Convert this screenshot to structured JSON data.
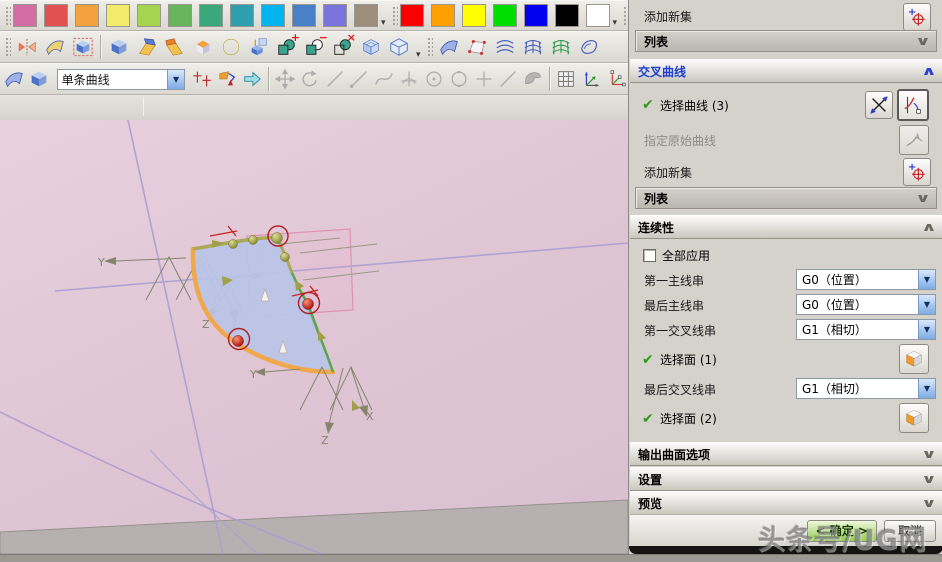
{
  "toolbar": {
    "palette1_colors": [
      "#d46da5",
      "#e05252",
      "#f5a23e",
      "#f2ea6a",
      "#a5d44e",
      "#68b55e",
      "#3aa87a",
      "#2f9fae",
      "#00b4f0",
      "#4a80c8",
      "#7b74dc",
      "#9c8d7c"
    ],
    "palette2_colors": [
      "#fa0000",
      "#ffa000",
      "#ffff00",
      "#00dd00",
      "#0000ee",
      "#000000",
      "#ffffff"
    ],
    "curve_rule_value": "单条曲线",
    "row2_icons": [
      {
        "type": "grip"
      },
      {
        "name": "mirror-feature-icon",
        "sym": "sym-mirror"
      },
      {
        "name": "sheet-body-icon",
        "sym": "sym-sheet2"
      },
      {
        "name": "sew-solid-icon",
        "sym": "sym-dashcube"
      },
      {
        "type": "sep"
      },
      {
        "name": "chamfer-cube-icon",
        "sym": "sym-cube"
      },
      {
        "name": "bend-sheet-icon",
        "sym": "sym-bend"
      },
      {
        "name": "flange-sheet-icon",
        "sym": "sym-bend2"
      },
      {
        "name": "thicken-sheet-icon",
        "sym": "sym-extrude"
      },
      {
        "name": "sphere-icon",
        "sym": "sym-sphere"
      },
      {
        "name": "boss-feature-icon",
        "sym": "sym-boss"
      },
      {
        "name": "unite-boolean-icon",
        "sym": "sym-bool-u",
        "badge": "+"
      },
      {
        "name": "subtract-boolean-icon",
        "sym": "sym-bool-s",
        "badge": "−"
      },
      {
        "name": "intersect-boolean-icon",
        "sym": "sym-bool-i",
        "badge": "×"
      },
      {
        "name": "shell-icon",
        "sym": "sym-shell"
      },
      {
        "name": "wireframe-cube-icon",
        "sym": "sym-wire"
      },
      {
        "type": "arrow"
      },
      {
        "type": "grip"
      },
      {
        "name": "swept-surface-icon",
        "sym": "sym-swept"
      },
      {
        "name": "bounded-plane-icon",
        "sym": "sym-plane"
      },
      {
        "name": "through-curves-icon",
        "sym": "sym-curves",
        "color": "#4a5fc0"
      },
      {
        "name": "through-curve-mesh-icon",
        "sym": "sym-mesh",
        "color": "#4a5fc0"
      },
      {
        "name": "studio-surface-icon",
        "sym": "sym-mesh",
        "color": "#2e9a4e"
      },
      {
        "name": "n-sided-surface-icon",
        "sym": "sym-nsided",
        "color": "#4a5fc0"
      }
    ],
    "row3_icons": [
      {
        "name": "extract-sheet-icon",
        "sym": "sym-swept"
      },
      {
        "name": "solid-cube-icon",
        "sym": "sym-cube"
      },
      {
        "type": "combo"
      },
      {
        "name": "point-constructor-icon",
        "sym": "sym-crosses"
      },
      {
        "name": "point-dialog-icon",
        "sym": "sym-pointdlg"
      },
      {
        "name": "direction-arrow-icon",
        "sym": "sym-cyanarrow"
      },
      {
        "type": "sep"
      },
      {
        "name": "move-handles-icon",
        "sym": "sym-move",
        "grayed": true
      },
      {
        "name": "rotate-handles-icon",
        "sym": "sym-rotate",
        "grayed": true
      },
      {
        "name": "line-icon",
        "sym": "sym-line",
        "grayed": true
      },
      {
        "name": "line-point-icon",
        "sym": "sym-linept",
        "grayed": true
      },
      {
        "name": "spline-icon",
        "sym": "sym-spline",
        "grayed": true
      },
      {
        "name": "arc-cross-icon",
        "sym": "sym-arc",
        "grayed": true
      },
      {
        "name": "circle-center-icon",
        "sym": "sym-circdot",
        "grayed": true
      },
      {
        "name": "circle-icon",
        "sym": "sym-circ",
        "grayed": true
      },
      {
        "name": "plus-point-icon",
        "sym": "sym-plus",
        "grayed": true
      },
      {
        "name": "slash-line-icon",
        "sym": "sym-line",
        "grayed": true
      },
      {
        "name": "patch-face-icon",
        "sym": "sym-blob",
        "grayed": true
      },
      {
        "type": "sep"
      },
      {
        "name": "grid-table-icon",
        "sym": "sym-grid"
      },
      {
        "name": "csys-orient-icon",
        "sym": "sym-csys"
      },
      {
        "name": "csys-dynamic-icon",
        "sym": "sym-csys2"
      }
    ]
  },
  "viewport": {
    "axis_y": "Y",
    "axis_z": "Z",
    "axis_x": "X",
    "colors": {
      "background_pink": "#dfc5d4",
      "surface": "#bac5e7",
      "primary_curve_orange": "#f0a84a",
      "cross_curve_green": "#57a848",
      "top_curve_olive": "#a9a958",
      "marker_red": "#c42222",
      "datum_purple": "#ab9ed3"
    }
  },
  "dialog": {
    "add_new_set_label": "添加新集",
    "list_label": "列表",
    "add_new_set2_label": "添加新集",
    "list2_label": "列表",
    "section_cross_curves": "交叉曲线",
    "section_continuity": "连续性",
    "section_output": "输出曲面选项",
    "section_settings": "设置",
    "section_preview": "预览",
    "select_curve_label": "选择曲线 (3)",
    "specify_origin_curve_label": "指定原始曲线",
    "apply_all_label": "全部应用",
    "continuity_rows": [
      {
        "label": "第一主线串",
        "value": "G0（位置）"
      },
      {
        "label": "最后主线串",
        "value": "G0（位置）"
      },
      {
        "label": "第一交叉线串",
        "value": "G1（相切）"
      },
      {
        "label": "最后交叉线串",
        "value": "G1（相切）"
      }
    ],
    "select_face1_label": "选择面 (1)",
    "select_face2_label": "选择面 (2)",
    "ok_label": "< 确定 >",
    "cancel_label": "取消",
    "accent_blue": "#2a3fd0",
    "ok_green": "#94cc54"
  },
  "watermark": "头条号/UG网"
}
